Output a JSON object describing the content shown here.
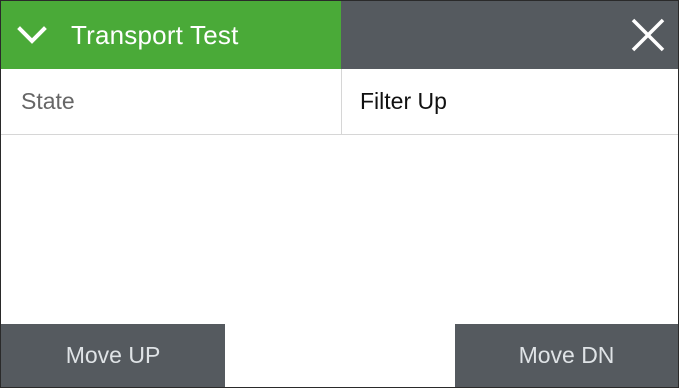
{
  "colors": {
    "header_green": "#4aaa38",
    "header_gray": "#555a5f",
    "button_gray": "#555a5f",
    "button_text": "#dfe3e6"
  },
  "header": {
    "title": "Transport Test",
    "expand_icon": "chevron-down-icon",
    "close_icon": "close-icon"
  },
  "table": {
    "rows": [
      {
        "label": "State",
        "value": "Filter Up"
      }
    ]
  },
  "buttons": {
    "move_up_label": "Move UP",
    "move_dn_label": "Move DN"
  }
}
